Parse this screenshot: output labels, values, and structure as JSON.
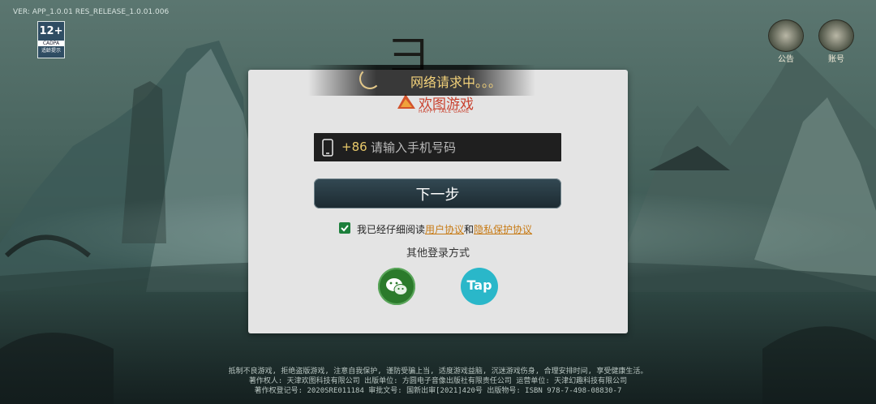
{
  "version": "VER: APP_1.0.01 RES_RELEASE_1.0.01.006",
  "age_badge": {
    "rating": "12+",
    "org": "CADPA",
    "hint": "适龄提示"
  },
  "top_buttons": [
    {
      "label": "公告",
      "icon": "scroll-icon"
    },
    {
      "label": "账号",
      "icon": "account-icon"
    }
  ],
  "loading": {
    "text": "网络请求中。。。"
  },
  "brand": {
    "name": "欢图游戏",
    "sub": "HAPPY TALE GAME"
  },
  "phone": {
    "country_code": "+86",
    "placeholder": "请输入手机号码",
    "value": ""
  },
  "next_button": "下一步",
  "agreement": {
    "checked": true,
    "prefix": "我已经仔细阅读",
    "link1": "用户协议",
    "joiner": "和",
    "link2": "隐私保护协议"
  },
  "other_login": {
    "title": "其他登录方式",
    "wechat_icon": "wechat-icon",
    "taptap_label": "Tap"
  },
  "footer": [
    "抵制不良游戏, 拒绝盗版游戏, 注意自我保护, 谨防受骗上当, 适度游戏益脑, 沉迷游戏伤身, 合理安排时间, 享受健康生活。",
    "著作权人: 天津欢图科技有限公司    出版单位: 方圆电子音像出版社有限责任公司 运营单位: 天津幻趣科技有限公司",
    "著作权登记号: 2020SRE011184 审批文号: 国新出审[2021]420号 出版物号: ISBN 978-7-498-08830-7"
  ],
  "colors": {
    "accent": "#c77a14",
    "loading_text": "#f3d27a",
    "wechat": "#2b7a2b",
    "taptap": "#2ab7c9"
  }
}
